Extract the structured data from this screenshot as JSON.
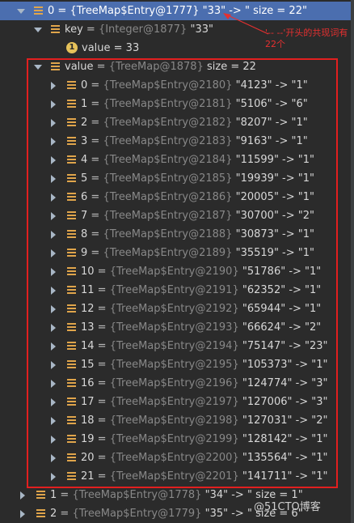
{
  "header_row": {
    "index": "0",
    "type": "{TreeMap$Entry@1777}",
    "value": "\"33\" -> \" size = 22\""
  },
  "key_row": {
    "name": "key",
    "type": "{Integer@1877}",
    "value": "\"33\""
  },
  "inner_value_row": {
    "name": "value",
    "value": "= 33"
  },
  "value_row": {
    "name": "value",
    "type": "{TreeMap@1878}",
    "value": "size = 22"
  },
  "entries": [
    {
      "index": "0",
      "type": "{TreeMap$Entry@2180}",
      "value": "\"4123\" -> \"1\""
    },
    {
      "index": "1",
      "type": "{TreeMap$Entry@2181}",
      "value": "\"5106\" -> \"6\""
    },
    {
      "index": "2",
      "type": "{TreeMap$Entry@2182}",
      "value": "\"8207\" -> \"1\""
    },
    {
      "index": "3",
      "type": "{TreeMap$Entry@2183}",
      "value": "\"9163\" -> \"1\""
    },
    {
      "index": "4",
      "type": "{TreeMap$Entry@2184}",
      "value": "\"11599\" -> \"1\""
    },
    {
      "index": "5",
      "type": "{TreeMap$Entry@2185}",
      "value": "\"19939\" -> \"1\""
    },
    {
      "index": "6",
      "type": "{TreeMap$Entry@2186}",
      "value": "\"20005\" -> \"1\""
    },
    {
      "index": "7",
      "type": "{TreeMap$Entry@2187}",
      "value": "\"30700\" -> \"2\""
    },
    {
      "index": "8",
      "type": "{TreeMap$Entry@2188}",
      "value": "\"30873\" -> \"1\""
    },
    {
      "index": "9",
      "type": "{TreeMap$Entry@2189}",
      "value": "\"35519\" -> \"1\""
    },
    {
      "index": "10",
      "type": "{TreeMap$Entry@2190}",
      "value": "\"51786\" -> \"1\""
    },
    {
      "index": "11",
      "type": "{TreeMap$Entry@2191}",
      "value": "\"62352\" -> \"1\""
    },
    {
      "index": "12",
      "type": "{TreeMap$Entry@2192}",
      "value": "\"65944\" -> \"1\""
    },
    {
      "index": "13",
      "type": "{TreeMap$Entry@2193}",
      "value": "\"66624\" -> \"2\""
    },
    {
      "index": "14",
      "type": "{TreeMap$Entry@2194}",
      "value": "\"75147\" -> \"23\""
    },
    {
      "index": "15",
      "type": "{TreeMap$Entry@2195}",
      "value": "\"105373\" -> \"1\""
    },
    {
      "index": "16",
      "type": "{TreeMap$Entry@2196}",
      "value": "\"124774\" -> \"3\""
    },
    {
      "index": "17",
      "type": "{TreeMap$Entry@2197}",
      "value": "\"127006\" -> \"3\""
    },
    {
      "index": "18",
      "type": "{TreeMap$Entry@2198}",
      "value": "\"127031\" -> \"2\""
    },
    {
      "index": "19",
      "type": "{TreeMap$Entry@2199}",
      "value": "\"128142\" -> \"1\""
    },
    {
      "index": "20",
      "type": "{TreeMap$Entry@2200}",
      "value": "\"135564\" -> \"1\""
    },
    {
      "index": "21",
      "type": "{TreeMap$Entry@2201}",
      "value": "\"141711\" -> \"1\""
    }
  ],
  "footer_rows": [
    {
      "index": "1",
      "type": "{TreeMap$Entry@1778}",
      "value": "\"34\" -> \" size = 1\""
    },
    {
      "index": "2",
      "type": "{TreeMap$Entry@1779}",
      "value": "\"35\" -> \" size = 6\""
    }
  ],
  "annotation": {
    "text": "'-- --'开头的共现词有22个"
  },
  "watermark": {
    "text": "@51CTO博客"
  },
  "colors": {
    "selected_row": "#4b6eaf",
    "highlight_box": "#e21f1f",
    "annotation": "#e53030"
  }
}
